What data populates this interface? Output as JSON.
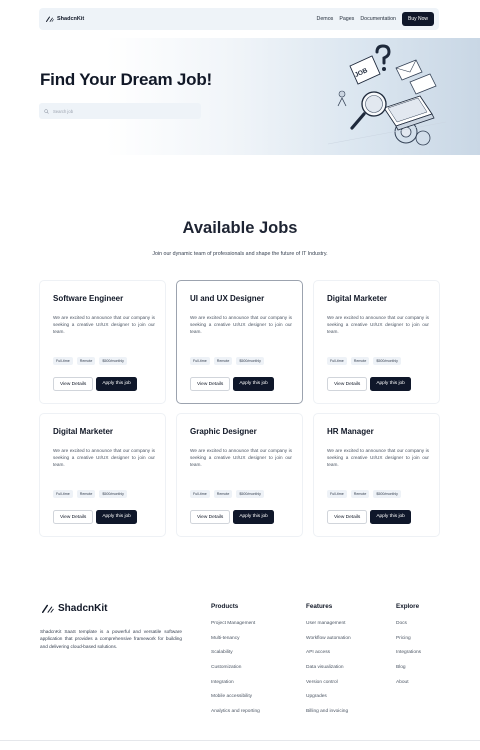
{
  "nav": {
    "brand": "ShadcnKit",
    "links": [
      "Demos",
      "Pages",
      "Documentation"
    ],
    "cta": "Buy Now"
  },
  "hero": {
    "title": "Find Your Dream Job!",
    "search_placeholder": "Search job",
    "illustration_text": "JOB"
  },
  "jobs": {
    "title": "Available Jobs",
    "subtitle": "Join our dynamic team of professionals and shape the future of IT Industry.",
    "cards": [
      {
        "title": "Software Engineer",
        "description": "We are excited to announce that our company is seeking a creative UI/UX designer to join our team.",
        "tags": [
          "Full-time",
          "Remote",
          "$500/monthly"
        ],
        "details_label": "View Details",
        "apply_label": "Apply this job",
        "active": false
      },
      {
        "title": "UI and UX Designer",
        "description": "We are excited to announce that our company is seeking a creative UI/UX designer to join our team.",
        "tags": [
          "Full-time",
          "Remote",
          "$500/monthly"
        ],
        "details_label": "View Details",
        "apply_label": "Apply this job",
        "active": true
      },
      {
        "title": "Digital Marketer",
        "description": "We are excited to announce that our company is seeking a creative UI/UX designer to join our team.",
        "tags": [
          "Full-time",
          "Remote",
          "$500/monthly"
        ],
        "details_label": "View Details",
        "apply_label": "Apply this job",
        "active": false
      },
      {
        "title": "Digital Marketer",
        "description": "We are excited to announce that our company is seeking a creative UI/UX designer to join our team.",
        "tags": [
          "Full-time",
          "Remote",
          "$500/monthly"
        ],
        "details_label": "View Details",
        "apply_label": "Apply this job",
        "active": false
      },
      {
        "title": "Graphic Designer",
        "description": "We are excited to announce that our company is seeking a creative UI/UX designer to join our team.",
        "tags": [
          "Full-time",
          "Remote",
          "$500/monthly"
        ],
        "details_label": "View Details",
        "apply_label": "Apply this job",
        "active": false
      },
      {
        "title": "HR Manager",
        "description": "We are excited to announce that our company is seeking a creative UI/UX designer to join our team.",
        "tags": [
          "Full-time",
          "Remote",
          "$500/monthly"
        ],
        "details_label": "View Details",
        "apply_label": "Apply this job",
        "active": false
      }
    ]
  },
  "footer": {
    "brand": "ShadcnKit",
    "description": "ShadcnKit SaaS template is a powerful and versatile software application that provides a comprehensive framework for building and delivering cloud-based solutions.",
    "columns": [
      {
        "title": "Products",
        "items": [
          "Project Management",
          "Multi-tenancy",
          "Scalability",
          "Customization",
          "Integration",
          "Mobile accessibility",
          "Analytics and reporting"
        ]
      },
      {
        "title": "Features",
        "items": [
          "User management",
          "Workflow automation",
          "API access",
          "Data visualization",
          "Version control",
          "Upgrades",
          "Billing and invoicing"
        ]
      },
      {
        "title": "Explore",
        "items": [
          "Docs",
          "Pricing",
          "Integrations",
          "Blog",
          "About"
        ]
      }
    ]
  },
  "colors": {
    "primary_dark": "#0f172a",
    "surface": "#eef3f8",
    "hero_gradient_end": "#c9d7e5"
  }
}
